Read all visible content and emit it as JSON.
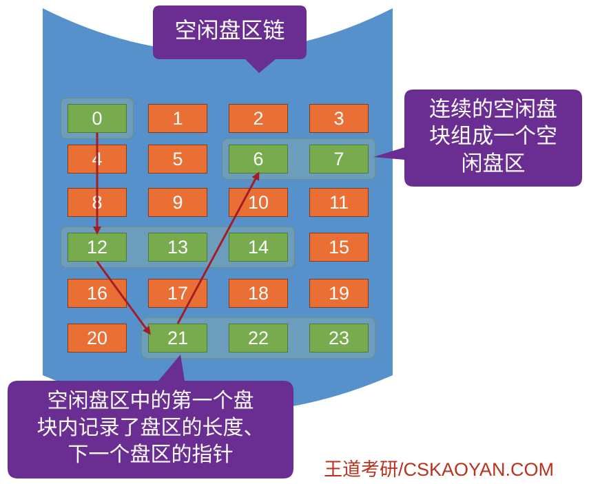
{
  "title_callout": {
    "text": "空闲盘区链"
  },
  "right_callout": {
    "lines": [
      "连续的空闲盘",
      "块组成一个空",
      "闲盘区"
    ]
  },
  "bottom_callout": {
    "lines": [
      "空闲盘区中的第一个盘",
      "块内记录了盘区的长度、",
      "下一个盘区的指针"
    ]
  },
  "blocks": [
    {
      "label": "0",
      "free": true
    },
    {
      "label": "1",
      "free": false
    },
    {
      "label": "2",
      "free": false
    },
    {
      "label": "3",
      "free": false
    },
    {
      "label": "4",
      "free": false
    },
    {
      "label": "5",
      "free": false
    },
    {
      "label": "6",
      "free": true
    },
    {
      "label": "7",
      "free": true
    },
    {
      "label": "8",
      "free": false
    },
    {
      "label": "9",
      "free": false
    },
    {
      "label": "10",
      "free": false
    },
    {
      "label": "11",
      "free": false
    },
    {
      "label": "12",
      "free": true
    },
    {
      "label": "13",
      "free": true
    },
    {
      "label": "14",
      "free": true
    },
    {
      "label": "15",
      "free": false
    },
    {
      "label": "16",
      "free": false
    },
    {
      "label": "17",
      "free": false
    },
    {
      "label": "18",
      "free": false
    },
    {
      "label": "19",
      "free": false
    },
    {
      "label": "20",
      "free": false
    },
    {
      "label": "21",
      "free": true
    },
    {
      "label": "22",
      "free": true
    },
    {
      "label": "23",
      "free": true
    }
  ],
  "free_regions": [
    [
      0
    ],
    [
      6,
      7
    ],
    [
      12,
      13,
      14
    ],
    [
      21,
      22,
      23
    ]
  ],
  "chain": [
    0,
    12,
    21,
    6
  ],
  "watermark": "王道考研/CSKAOYAN.COM",
  "colors": {
    "cylinder": "#5691cb",
    "cylinder_top": "#ffffff",
    "used_block": "#ea6f35",
    "free_block": "#78ab4d",
    "callout": "#6a2d91",
    "arrow": "#a21e27",
    "watermark": "#b8321e"
  }
}
